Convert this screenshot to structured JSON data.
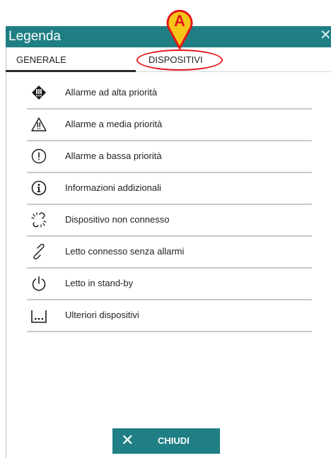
{
  "dialog": {
    "title": "Legenda",
    "close_glyph": "✕"
  },
  "tabs": [
    {
      "label": "GENERALE",
      "active": true
    },
    {
      "label": "DISPOSITIVI",
      "active": false
    }
  ],
  "callout": {
    "letter": "A",
    "color": "#e4161b"
  },
  "legend": {
    "items": [
      {
        "icon": "high-priority-alarm-icon",
        "label": "Allarme ad alta priorità"
      },
      {
        "icon": "medium-priority-alarm-icon",
        "label": "Allarme a media priorità"
      },
      {
        "icon": "low-priority-alarm-icon",
        "label": "Allarme a bassa priorità"
      },
      {
        "icon": "info-icon",
        "label": "Informazioni addizionali"
      },
      {
        "icon": "device-disconnected-icon",
        "label": "Dispositivo non connesso"
      },
      {
        "icon": "bed-connected-icon",
        "label": "Letto connesso senza allarmi"
      },
      {
        "icon": "standby-icon",
        "label": "Letto in stand-by"
      },
      {
        "icon": "more-devices-icon",
        "label": "Ulteriori dispositivi"
      }
    ]
  },
  "footer": {
    "close_label": "CHIUDI",
    "close_glyph": "✕"
  },
  "colors": {
    "accent": "#1f7f84",
    "callout": "#e4161b"
  }
}
